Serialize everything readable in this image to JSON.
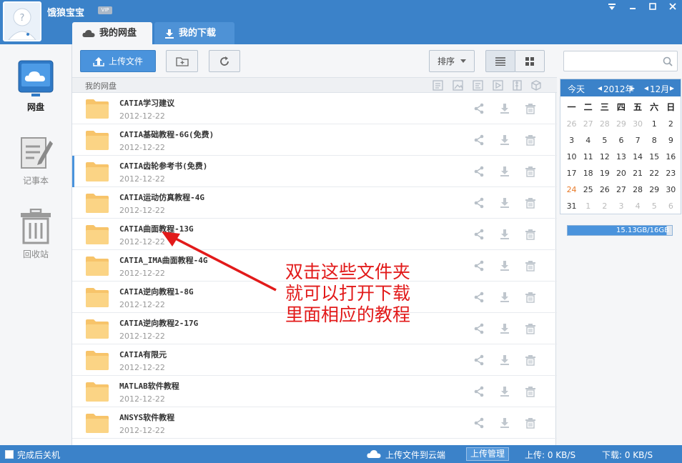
{
  "app": {
    "username": "饿狼宝宝",
    "vip_badge": "VIP"
  },
  "window_controls": [
    "menu-icon",
    "minimize-icon",
    "maximize-icon",
    "close-icon"
  ],
  "tabs": [
    {
      "label": "我的网盘",
      "icon": "cloud-icon",
      "active": true
    },
    {
      "label": "我的下载",
      "icon": "download-icon",
      "active": false
    }
  ],
  "sidebar": {
    "items": [
      {
        "label": "网盘",
        "icon": "netdisk-icon",
        "active": true
      },
      {
        "label": "记事本",
        "icon": "notepad-icon",
        "active": false
      },
      {
        "label": "回收站",
        "icon": "recycle-bin-icon",
        "active": false
      }
    ]
  },
  "toolbar": {
    "upload_label": "上传文件",
    "sort_label": "排序"
  },
  "breadcrumb": "我的网盘",
  "files": [
    {
      "name": "CATIA学习建议",
      "date": "2012-12-22"
    },
    {
      "name": "CATIA基础教程-6G(免费)",
      "date": "2012-12-22"
    },
    {
      "name": "CATIA齿轮参考书(免费)",
      "date": "2012-12-22"
    },
    {
      "name": "CATIA运动仿真教程-4G",
      "date": "2012-12-22"
    },
    {
      "name": "CATIA曲面教程-13G",
      "date": "2012-12-22"
    },
    {
      "name": "CATIA_IMA曲面教程-4G",
      "date": "2012-12-22"
    },
    {
      "name": "CATIA逆向教程1-8G",
      "date": "2012-12-22"
    },
    {
      "name": "CATIA逆向教程2-17G",
      "date": "2012-12-22"
    },
    {
      "name": "CATIA有限元",
      "date": "2012-12-22"
    },
    {
      "name": "MATLAB软件教程",
      "date": "2012-12-22"
    },
    {
      "name": "ANSYS软件教程",
      "date": "2012-12-22"
    }
  ],
  "selected_row": 2,
  "annotation": {
    "lines": [
      "双击这些文件夹",
      "就可以打开下载",
      "里面相应的教程"
    ],
    "color": "#e21a1a"
  },
  "calendar": {
    "today_label": "今天",
    "year_label": "2012年",
    "month_label": "12月",
    "weekdays": [
      "一",
      "二",
      "三",
      "四",
      "五",
      "六",
      "日"
    ],
    "weeks": [
      [
        "26",
        "27",
        "28",
        "29",
        "30",
        "1",
        "2"
      ],
      [
        "3",
        "4",
        "5",
        "6",
        "7",
        "8",
        "9"
      ],
      [
        "10",
        "11",
        "12",
        "13",
        "14",
        "15",
        "16"
      ],
      [
        "17",
        "18",
        "19",
        "20",
        "21",
        "22",
        "23"
      ],
      [
        "24",
        "25",
        "26",
        "27",
        "28",
        "29",
        "30"
      ],
      [
        "31",
        "1",
        "2",
        "3",
        "4",
        "5",
        "6"
      ]
    ],
    "today": "24"
  },
  "quota": {
    "label": "15.13GB/16GB",
    "used_fraction": 0.946
  },
  "statusbar": {
    "shutdown_label": "完成后关机",
    "upload_to_cloud": "上传文件到云端",
    "upload_manager": "上传管理",
    "upload_speed": "上传: 0 KB/S",
    "download_speed": "下载: 0 KB/S"
  },
  "colors": {
    "brand": "#3b82c9",
    "folder": "#f7c46a"
  }
}
